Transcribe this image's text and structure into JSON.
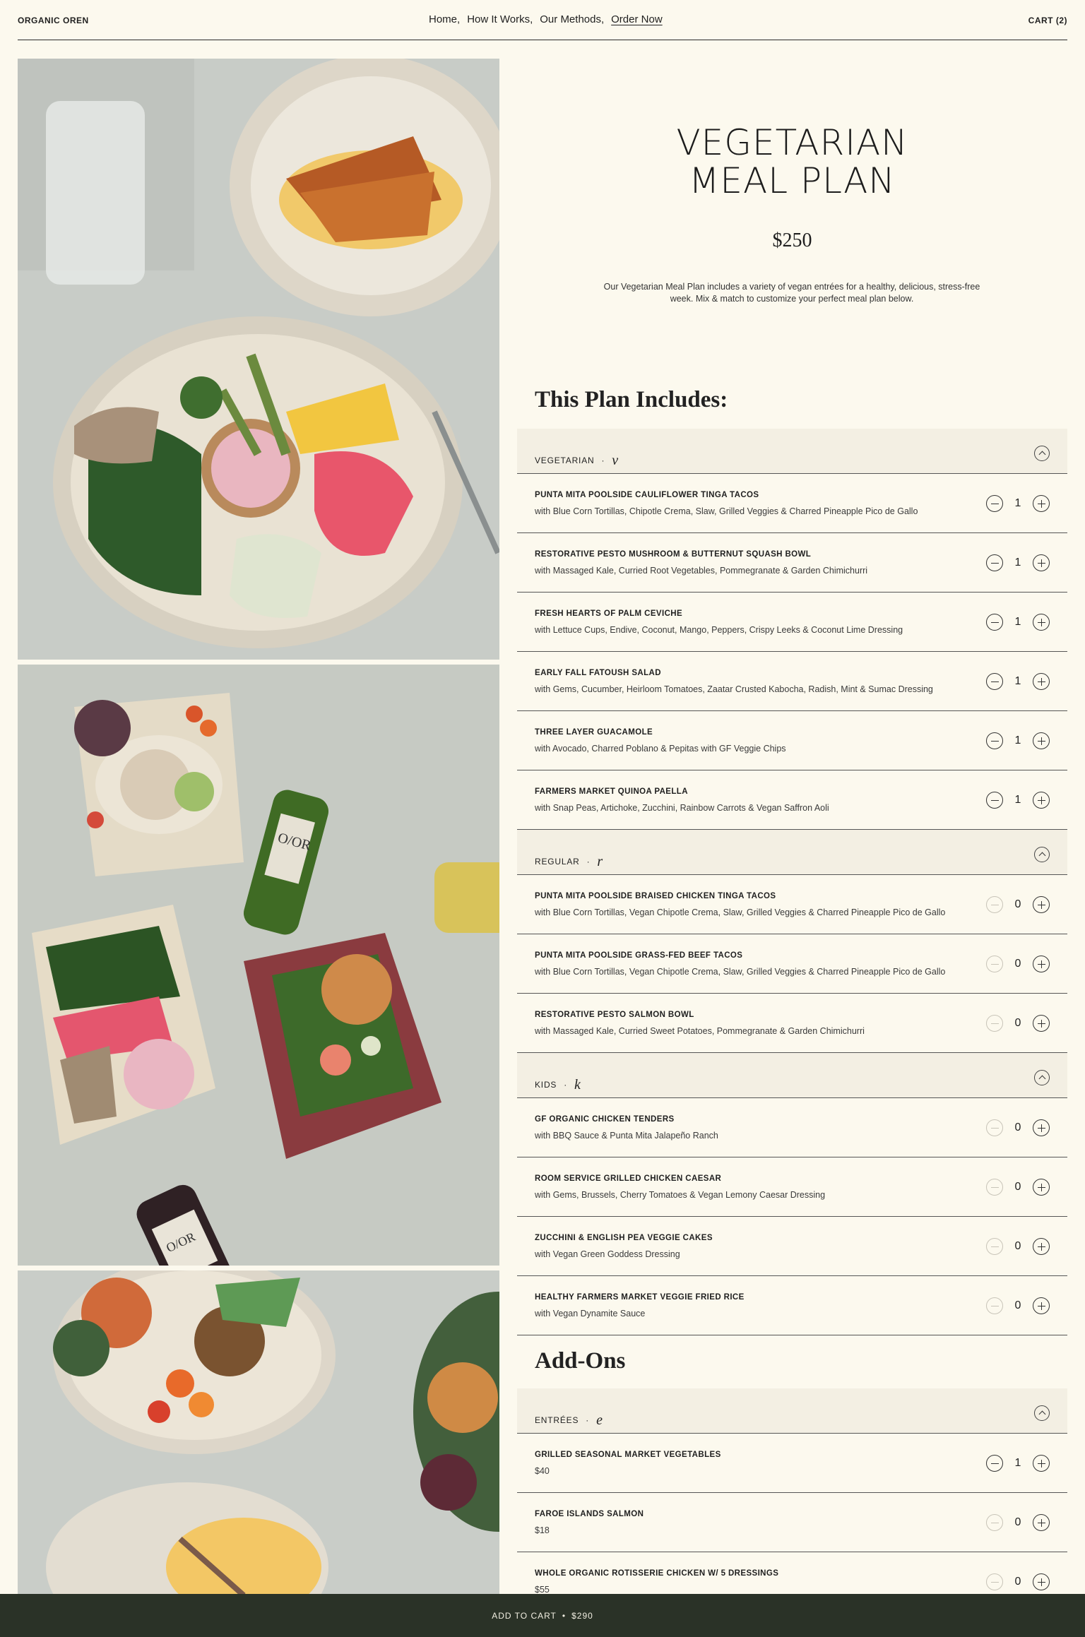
{
  "header": {
    "brand": "ORGANIC OREN",
    "nav": [
      {
        "label": "Home,"
      },
      {
        "label": "How It Works,"
      },
      {
        "label": "Our Methods,"
      },
      {
        "label": "Order Now"
      }
    ],
    "cart": "CART (2)"
  },
  "product": {
    "title_line1": "VEGETARIAN",
    "title_line2": "MEAL PLAN",
    "price": "$250",
    "description": "Our Vegetarian Meal Plan includes a variety of vegan entrées for a healthy, delicious, stress-free week. Mix & match to customize your perfect meal plan below."
  },
  "plan": {
    "heading": "This Plan Includes:",
    "categories": [
      {
        "label": "VEGETARIAN",
        "letter": "v",
        "items": [
          {
            "name": "PUNTA MITA POOLSIDE CAULIFLOWER TINGA TACOS",
            "desc": "with Blue Corn Tortillas, Chipotle Crema, Slaw, Grilled Veggies & Charred Pineapple Pico de Gallo",
            "qty": "1"
          },
          {
            "name": "RESTORATIVE PESTO MUSHROOM & BUTTERNUT SQUASH BOWL",
            "desc": "with Massaged Kale, Curried Root Vegetables, Pommegranate & Garden Chimichurri",
            "qty": "1"
          },
          {
            "name": "FRESH HEARTS OF PALM CEVICHE",
            "desc": "with Lettuce Cups, Endive, Coconut, Mango, Peppers, Crispy Leeks & Coconut Lime Dressing",
            "qty": "1"
          },
          {
            "name": "EARLY FALL FATOUSH SALAD",
            "desc": "with Gems, Cucumber, Heirloom Tomatoes, Zaatar Crusted Kabocha, Radish, Mint & Sumac Dressing",
            "qty": "1"
          },
          {
            "name": "THREE LAYER GUACAMOLE",
            "desc": "with Avocado, Charred Poblano & Pepitas with GF Veggie Chips",
            "qty": "1"
          },
          {
            "name": "FARMERS MARKET QUINOA PAELLA",
            "desc": "with Snap Peas, Artichoke, Zucchini, Rainbow Carrots & Vegan Saffron Aoli",
            "qty": "1"
          }
        ]
      },
      {
        "label": "REGULAR",
        "letter": "r",
        "items": [
          {
            "name": "PUNTA MITA POOLSIDE BRAISED CHICKEN TINGA TACOS",
            "desc": "with Blue Corn Tortillas, Vegan Chipotle Crema, Slaw, Grilled Veggies & Charred Pineapple Pico de Gallo",
            "qty": "0"
          },
          {
            "name": "PUNTA MITA POOLSIDE GRASS-FED BEEF TACOS",
            "desc": "with Blue Corn Tortillas, Vegan Chipotle Crema, Slaw, Grilled Veggies & Charred Pineapple Pico de Gallo",
            "qty": "0"
          },
          {
            "name": "RESTORATIVE PESTO SALMON BOWL",
            "desc": "with Massaged Kale, Curried Sweet Potatoes, Pommegranate & Garden Chimichurri",
            "qty": "0"
          }
        ]
      },
      {
        "label": "KIDS",
        "letter": "k",
        "items": [
          {
            "name": "GF ORGANIC CHICKEN TENDERS",
            "desc": "with BBQ Sauce & Punta Mita Jalapeño Ranch",
            "qty": "0"
          },
          {
            "name": "ROOM SERVICE GRILLED CHICKEN CAESAR",
            "desc": "with Gems, Brussels, Cherry Tomatoes & Vegan Lemony Caesar Dressing",
            "qty": "0"
          },
          {
            "name": "ZUCCHINI & ENGLISH PEA VEGGIE CAKES",
            "desc": "with Vegan Green Goddess Dressing",
            "qty": "0"
          },
          {
            "name": "HEALTHY FARMERS MARKET VEGGIE FRIED RICE",
            "desc": "with Vegan Dynamite Sauce",
            "qty": "0"
          }
        ]
      }
    ]
  },
  "addons": {
    "heading": "Add-Ons",
    "categories": [
      {
        "label": "ENTRÉES",
        "letter": "e",
        "items": [
          {
            "name": "GRILLED SEASONAL MARKET VEGETABLES",
            "desc": "$40",
            "qty": "1"
          },
          {
            "name": "FAROE ISLANDS SALMON",
            "desc": "$18",
            "qty": "0"
          },
          {
            "name": "WHOLE ORGANIC ROTISSERIE CHICKEN W/ 5 DRESSINGS",
            "desc": "$55",
            "qty": "0"
          }
        ]
      }
    ]
  },
  "bottom_bar": {
    "label": "ADD TO CART",
    "separator": "•",
    "total": "$290"
  },
  "photos": {
    "bottle_label_1": "O/OR",
    "bottle_label_2": "O/OR"
  },
  "colors": {
    "background": "#fcf9ee",
    "category_bg": "#f3efe3",
    "bottom_bar": "#2a3227"
  }
}
